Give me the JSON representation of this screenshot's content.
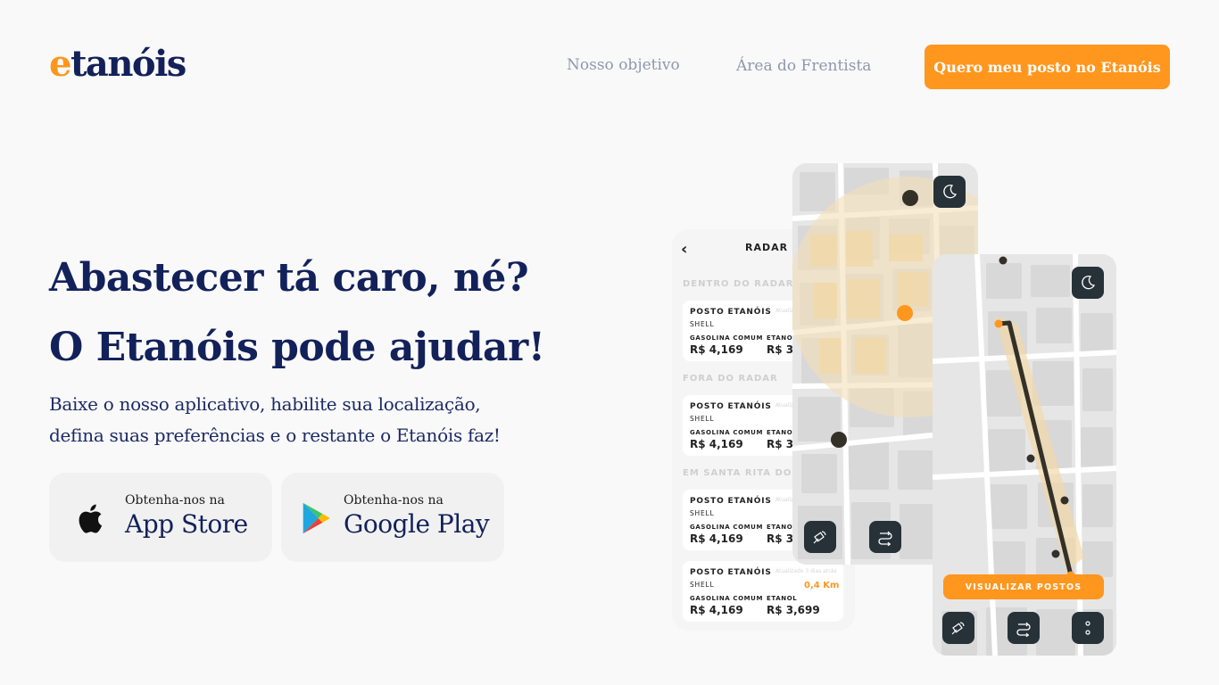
{
  "header": {
    "logo_e": "e",
    "logo_rest": "tanóis",
    "nav": [
      "Nosso objetivo",
      "Área do Frentista"
    ],
    "cta": "Quero meu posto no Etanóis"
  },
  "hero": {
    "title_line1": "Abastecer tá caro, né?",
    "title_line2": "O Etanóis pode ajudar!",
    "lead_line1": "Baixe o nosso aplicativo, habilite sua localização,",
    "lead_line2": "defina suas preferências e o restante o Etanóis faz!"
  },
  "stores": {
    "apple": {
      "small": "Obtenha-nos na",
      "big": "App Store",
      "icon": "apple-icon"
    },
    "google": {
      "small": "Obtenha-nos na",
      "big": "Google Play",
      "icon": "google-play-icon"
    }
  },
  "app_radar": {
    "back": "‹",
    "title": "RADAR",
    "sections": [
      "DENTRO DO RADAR",
      "FORA DO RADAR",
      "EM SANTA RITA DO"
    ],
    "cards": [
      {
        "name": "POSTO ETANÓIS",
        "brand": "SHELL",
        "updated": "Atualizado",
        "distance": "",
        "fuel1": "GASOLINA COMUM",
        "price1": "R$ 4,169",
        "fuel2": "ETANOL",
        "price2": "R$ 3,"
      },
      {
        "name": "POSTO ETANÓIS",
        "brand": "SHELL",
        "updated": "Atualizado",
        "distance": "",
        "fuel1": "GASOLINA COMUM",
        "price1": "R$ 4,169",
        "fuel2": "ETANOL",
        "price2": "R$ 3,"
      },
      {
        "name": "POSTO ETANÓIS",
        "brand": "SHELL",
        "updated": "Atualizado",
        "distance": "",
        "fuel1": "GASOLINA COMUM",
        "price1": "R$ 4,169",
        "fuel2": "ETANOL",
        "price2": "R$ 3,"
      },
      {
        "name": "POSTO ETANÓIS",
        "brand": "SHELL",
        "updated": "Atualizado 3 dias atrás",
        "distance": "0,4 Km",
        "fuel1": "GASOLINA COMUM",
        "price1": "R$ 4,169",
        "fuel2": "ETANOL",
        "price2": "R$ 3,699"
      }
    ]
  },
  "app_map2": {
    "button": "VISUALIZAR POSTOS"
  },
  "colors": {
    "brand_navy": "#13215a",
    "accent_orange": "#ff961e",
    "nav_gray": "#9097ae",
    "map_button": "#263238"
  },
  "icons": [
    "moon-icon",
    "satellite-icon",
    "route-icon",
    "more-icon"
  ]
}
